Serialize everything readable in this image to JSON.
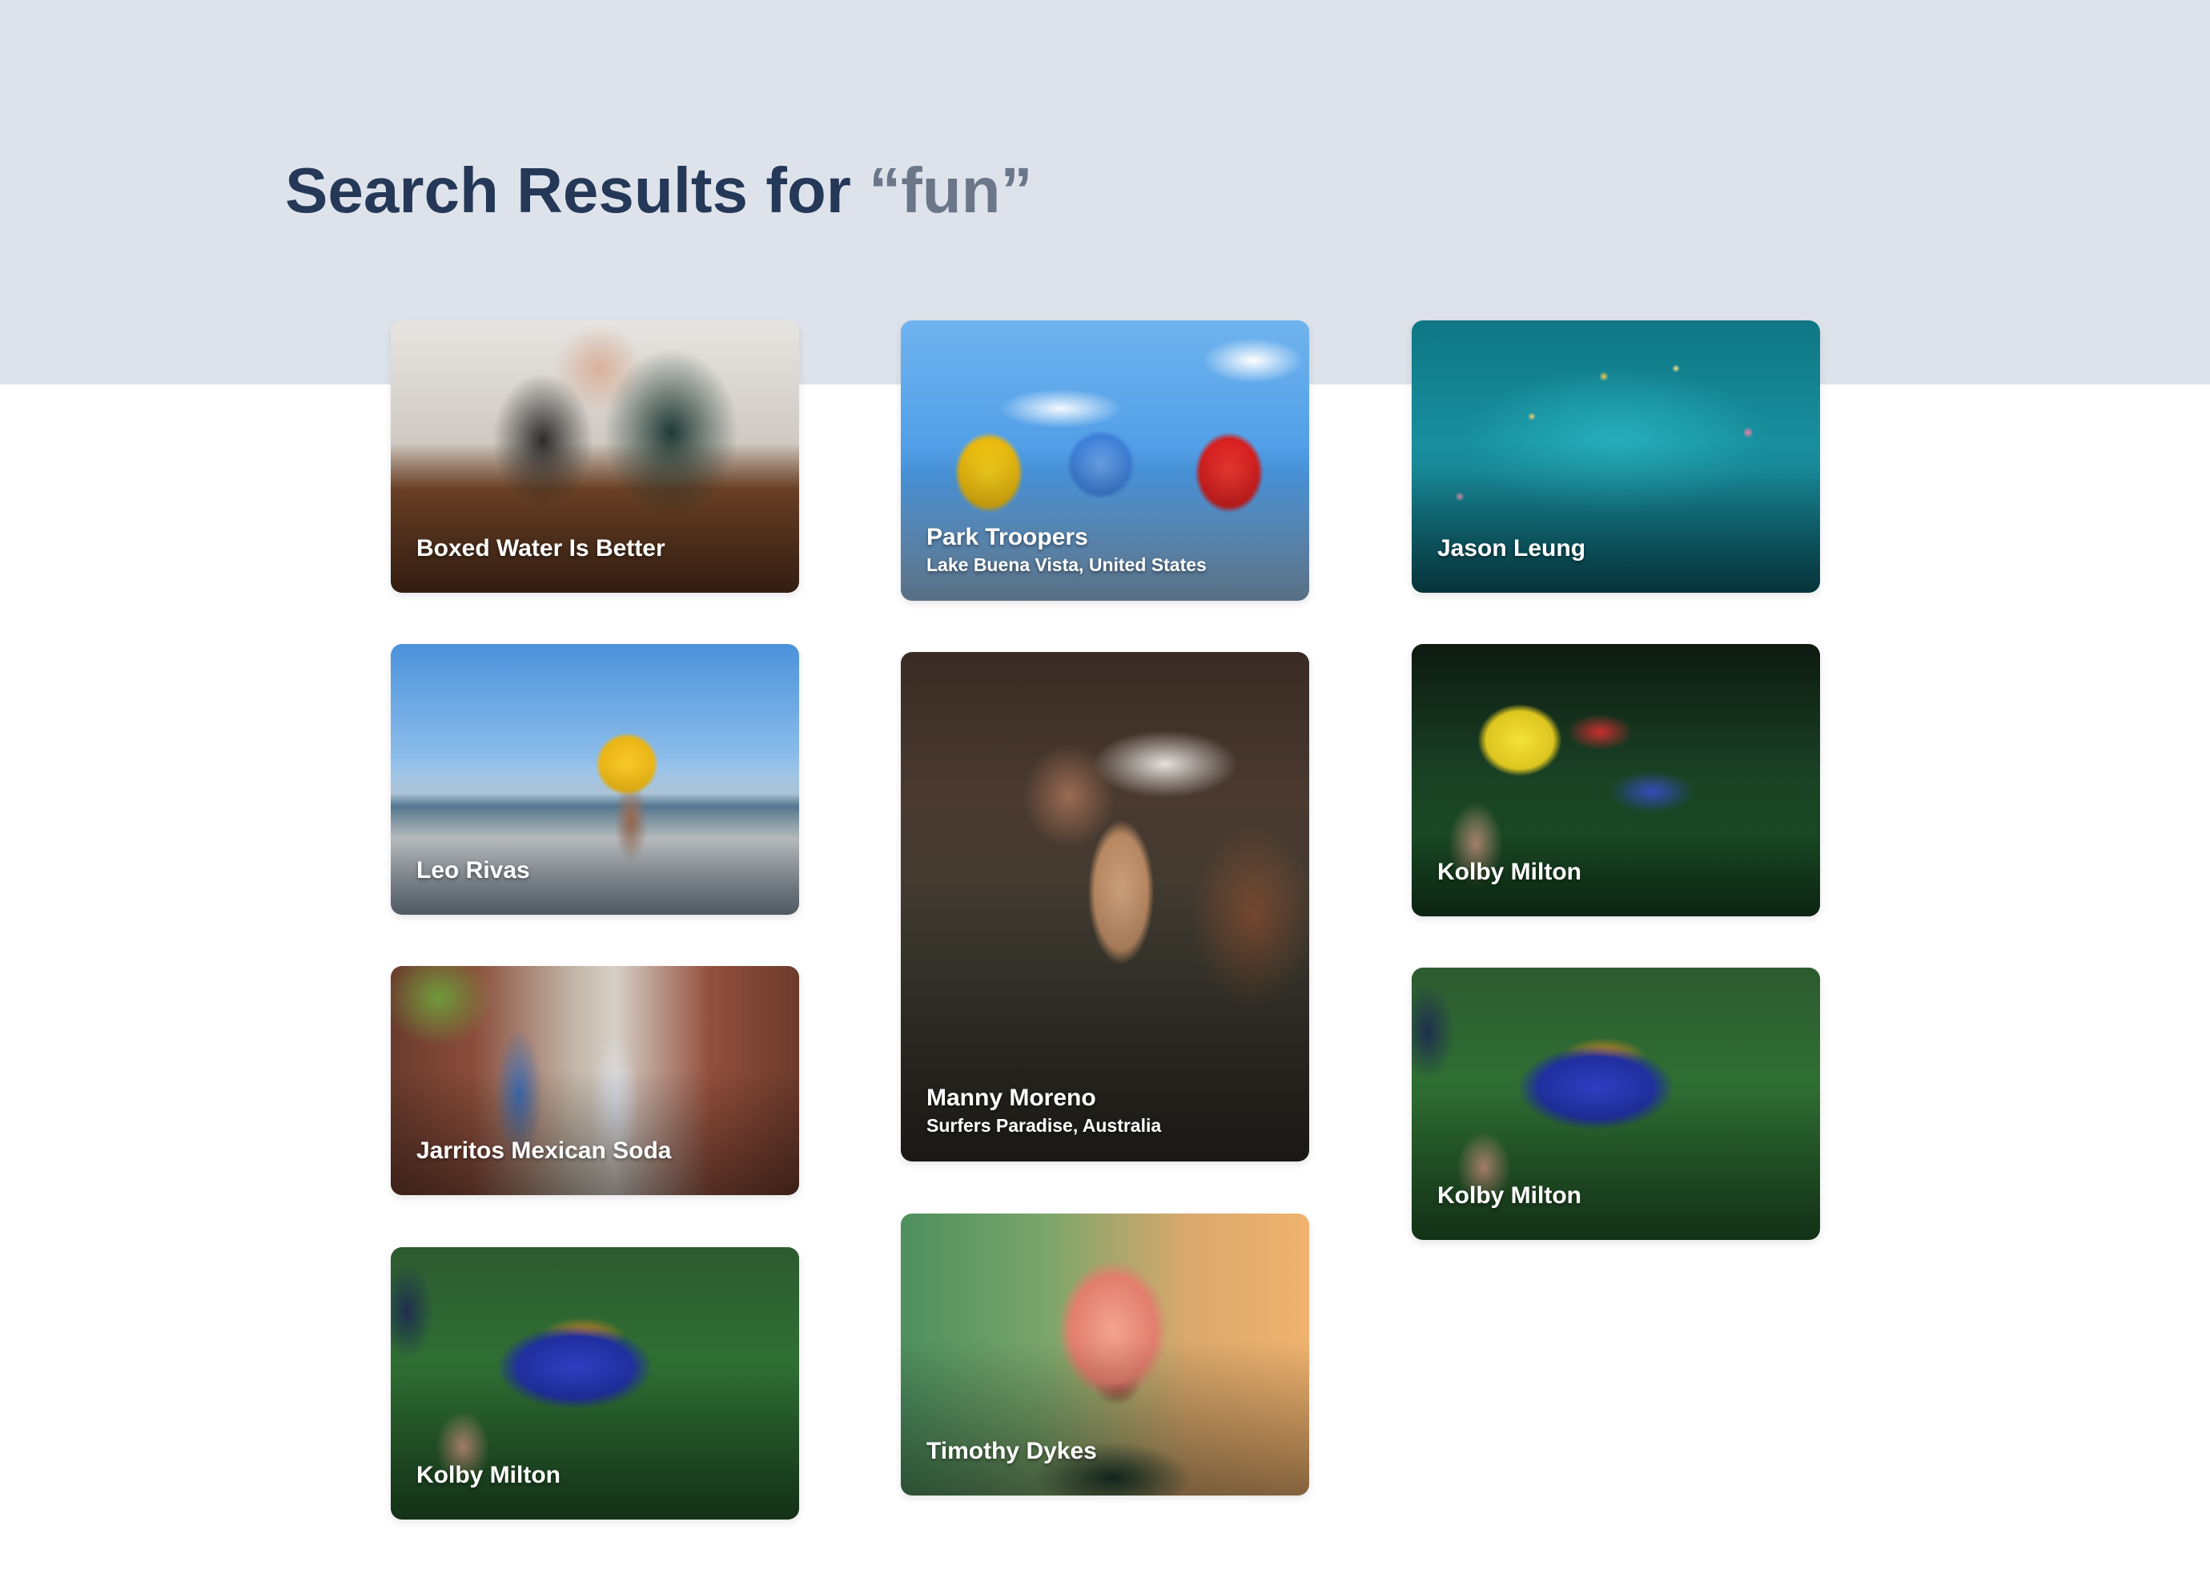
{
  "header": {
    "title_prefix": "Search Results for ",
    "query": "“fun”"
  },
  "results": [
    {
      "title": "Boxed Water Is Better",
      "subtitle": ""
    },
    {
      "title": "Park Troopers",
      "subtitle": "Lake Buena Vista, United States"
    },
    {
      "title": "Jason Leung",
      "subtitle": ""
    },
    {
      "title": "Leo Rivas",
      "subtitle": ""
    },
    {
      "title": "Manny Moreno",
      "subtitle": "Surfers Paradise, Australia"
    },
    {
      "title": "Kolby Milton",
      "subtitle": ""
    },
    {
      "title": "Jarritos Mexican Soda",
      "subtitle": ""
    },
    {
      "title": "Timothy Dykes",
      "subtitle": ""
    },
    {
      "title": "Kolby Milton",
      "subtitle": ""
    },
    {
      "title": "Kolby Milton",
      "subtitle": ""
    }
  ],
  "colors": {
    "hero_background": "#dee3eb",
    "title_text": "#253858",
    "query_text": "#6b7789"
  }
}
